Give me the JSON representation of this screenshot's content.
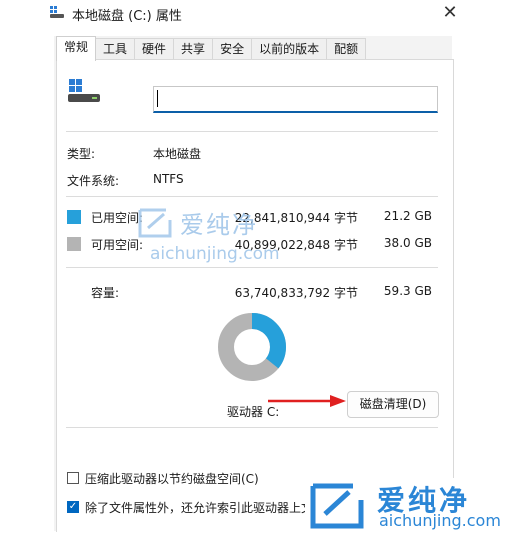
{
  "window": {
    "title": "本地磁盘 (C:) 属性",
    "close_glyph": "✕"
  },
  "tabs": [
    {
      "label": "常规",
      "active": true
    },
    {
      "label": "工具",
      "active": false
    },
    {
      "label": "硬件",
      "active": false
    },
    {
      "label": "共享",
      "active": false
    },
    {
      "label": "安全",
      "active": false
    },
    {
      "label": "以前的版本",
      "active": false
    },
    {
      "label": "配额",
      "active": false
    }
  ],
  "general": {
    "name_value": "",
    "type_label": "类型:",
    "type_value": "本地磁盘",
    "fs_label": "文件系统:",
    "fs_value": "NTFS",
    "used_label": "已用空间:",
    "used_bytes": "22,841,810,944 字节",
    "used_gb": "21.2 GB",
    "free_label": "可用空间:",
    "free_bytes": "40,899,022,848 字节",
    "free_gb": "38.0 GB",
    "capacity_label": "容量:",
    "capacity_bytes": "63,740,833,792 字节",
    "capacity_gb": "59.3 GB",
    "drive_label": "驱动器 C:",
    "cleanup_button": "磁盘清理(D)",
    "compress_label": "压缩此驱动器以节约磁盘空间(C)",
    "compress_checked": false,
    "index_label": "除了文件属性外，还允许索引此驱动器上文",
    "index_checked": true
  },
  "usage": {
    "used_fraction": 0.358,
    "used_color": "#26a0da",
    "free_color": "#b4b4b4"
  },
  "watermark": {
    "brand": "爱纯净",
    "url": "aichunjing.com"
  }
}
